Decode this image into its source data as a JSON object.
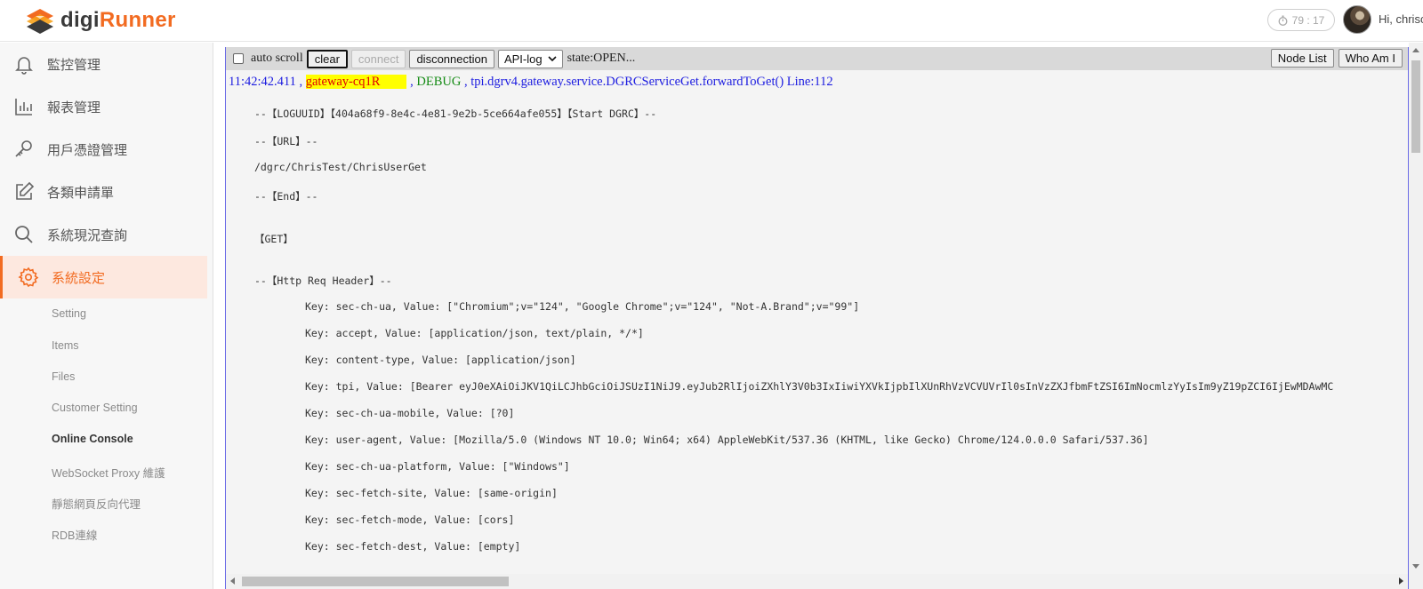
{
  "header": {
    "logo_brand": "digi",
    "logo_accent": "Runner",
    "timer": "79 : 17",
    "greeting": "Hi, chrisc"
  },
  "sidebar": {
    "items": [
      {
        "label": "監控管理",
        "icon": "bell-icon"
      },
      {
        "label": "報表管理",
        "icon": "bar-chart-icon"
      },
      {
        "label": "用戶憑證管理",
        "icon": "key-icon"
      },
      {
        "label": "各類申請單",
        "icon": "edit-icon"
      },
      {
        "label": "系統現況查詢",
        "icon": "search-icon"
      },
      {
        "label": "系統設定",
        "icon": "gear-icon"
      }
    ],
    "subitems": [
      "Setting",
      "Items",
      "Files",
      "Customer Setting",
      "Online Console",
      "WebSocket Proxy 維護",
      "靜態網頁反向代理",
      "RDB連線"
    ],
    "active_color": "#f26b21"
  },
  "toolbar": {
    "auto_scroll": "auto scroll",
    "clear": "clear",
    "connect": "connect",
    "disconnection": "disconnection",
    "select_value": "API-log",
    "state": "state:OPEN...",
    "node_list": "Node List",
    "who_am_i": "Who Am I"
  },
  "log": {
    "time": "11:42:42.411",
    "sep1": ",",
    "node": "gateway-cq1R",
    "sep2": ",",
    "level": "DEBUG",
    "sep3": ",",
    "method": "tpi.dgrv4.gateway.service.DGRCServiceGet.forwardToGet() Line:112",
    "lines": [
      "--【LOGUUID】【404a68f9-8e4c-4e81-9e2b-5ce664afe055】【Start DGRC】--",
      "--【URL】--",
      "/dgrc/ChrisTest/ChrisUserGet",
      "--【End】--",
      "【GET】",
      "--【Http Req Header】--",
      "Key: sec-ch-ua, Value: [\"Chromium\";v=\"124\", \"Google Chrome\";v=\"124\", \"Not-A.Brand\";v=\"99\"]",
      "Key: accept, Value: [application/json, text/plain, */*]",
      "Key: content-type, Value: [application/json]",
      "Key: tpi, Value: [Bearer eyJ0eXAiOiJKV1QiLCJhbGciOiJSUzI1NiJ9.eyJub2RlIjoiZXhlY3V0b3IxIiwiYXVkIjpbIlXUnRhVzVCVUVrIl0sInVzZXJfbmFtZSI6ImNocmlzYyIsIm9yZ19pZCI6IjEwMDAwMC",
      "Key: sec-ch-ua-mobile, Value: [?0]",
      "Key: user-agent, Value: [Mozilla/5.0 (Windows NT 10.0; Win64; x64) AppleWebKit/537.36 (KHTML, like Gecko) Chrome/124.0.0.0 Safari/537.36]",
      "Key: sec-ch-ua-platform, Value: [\"Windows\"]",
      "Key: sec-fetch-site, Value: [same-origin]",
      "Key: sec-fetch-mode, Value: [cors]",
      "Key: sec-fetch-dest, Value: [empty]"
    ]
  }
}
